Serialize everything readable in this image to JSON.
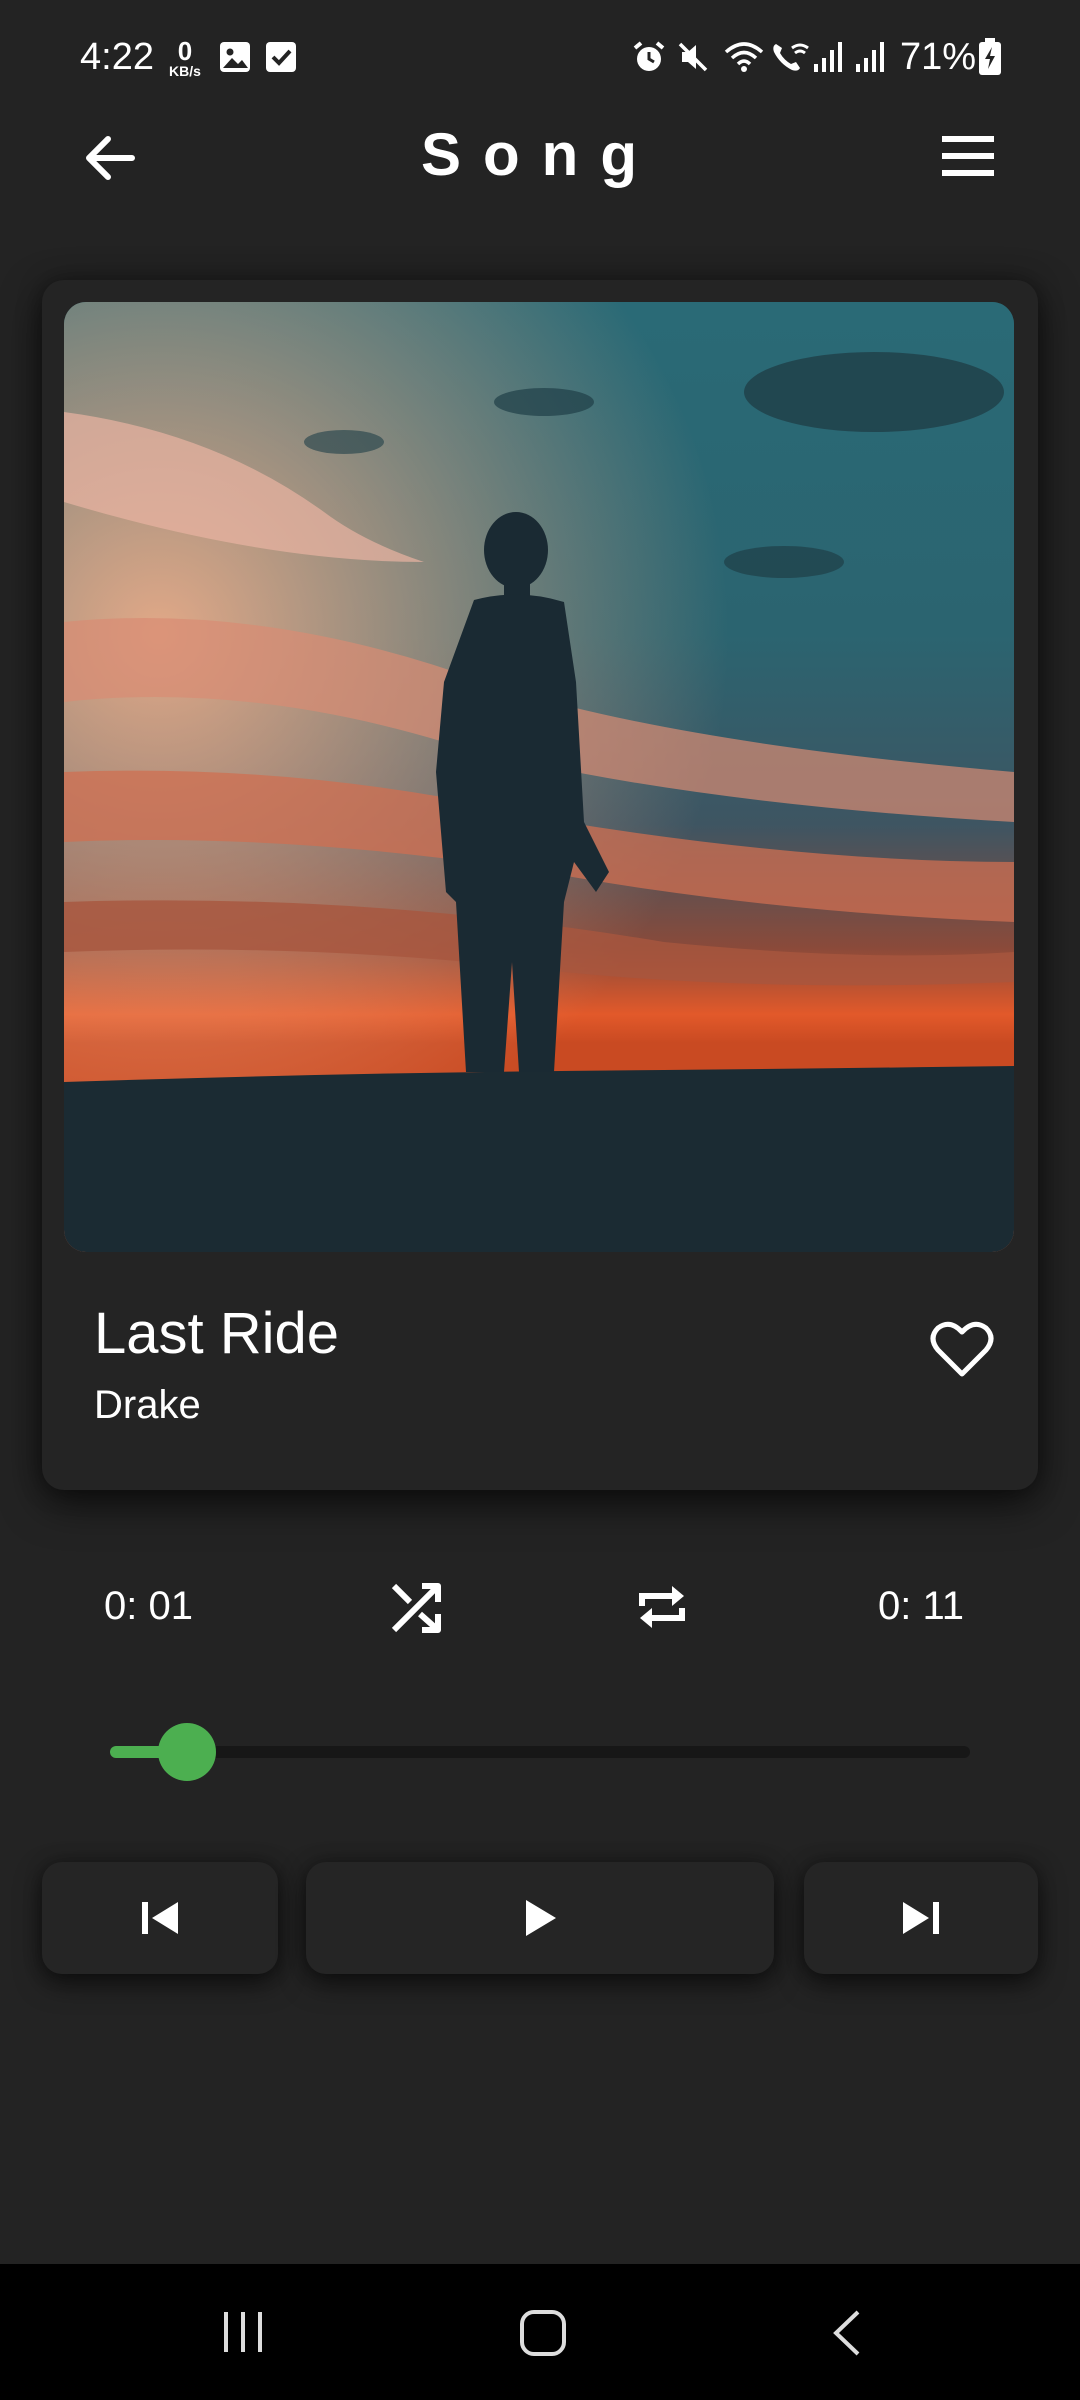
{
  "status_bar": {
    "time": "4:22",
    "net_speed_value": "0",
    "net_speed_unit": "KB/s",
    "battery": "71%",
    "icons": [
      "gallery-icon",
      "checkbox-icon",
      "alarm-icon",
      "mute-icon",
      "wifi-icon",
      "wifi-call-icon",
      "signal-icon",
      "signal-icon",
      "battery-charging-icon"
    ]
  },
  "header": {
    "title": "Song",
    "back_icon": "arrow-left-icon",
    "menu_icon": "hamburger-menu-icon"
  },
  "song": {
    "title": "Last Ride",
    "artist": "Drake",
    "artwork": "silhouette-sunset-artwork",
    "favorite_icon": "heart-outline-icon"
  },
  "player": {
    "elapsed": "0: 01",
    "total": "0: 11",
    "progress": 0.09,
    "accent_color": "#4caf50",
    "shuffle_icon": "shuffle-icon",
    "repeat_icon": "repeat-icon",
    "prev_icon": "skip-previous-icon",
    "play_icon": "play-icon",
    "next_icon": "skip-next-icon"
  },
  "nav_bar": {
    "icons": [
      "recent-apps-icon",
      "home-icon",
      "back-icon"
    ]
  },
  "colors": {
    "background": "#232323",
    "card": "#242424"
  }
}
